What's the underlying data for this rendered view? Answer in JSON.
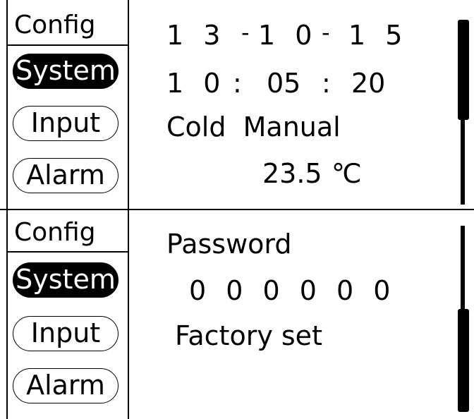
{
  "panels": [
    {
      "sidebar": {
        "title": "Config",
        "items": [
          {
            "label": "System",
            "active": true
          },
          {
            "label": "Input",
            "active": false
          },
          {
            "label": "Alarm",
            "active": false
          }
        ]
      },
      "main": {
        "date": {
          "year": "1 3",
          "sep1": "-",
          "month": "1 0",
          "sep2": "-",
          "day": "1 5"
        },
        "time": {
          "hour": "1 0",
          "sep1": ":",
          "minute": "05",
          "sep2": ":",
          "second": "20"
        },
        "mode_line": "Cold  Manual",
        "temperature": "23.5",
        "temperature_unit": "℃"
      }
    },
    {
      "sidebar": {
        "title": "Config",
        "items": [
          {
            "label": "System",
            "active": true
          },
          {
            "label": "Input",
            "active": false
          },
          {
            "label": "Alarm",
            "active": false
          }
        ]
      },
      "main": {
        "password_label": "Password",
        "password_value": "0 0 0 0 0 0",
        "factory_label": "Factory set"
      }
    }
  ],
  "colors": {
    "foreground": "#000000",
    "background": "#ffffff"
  }
}
